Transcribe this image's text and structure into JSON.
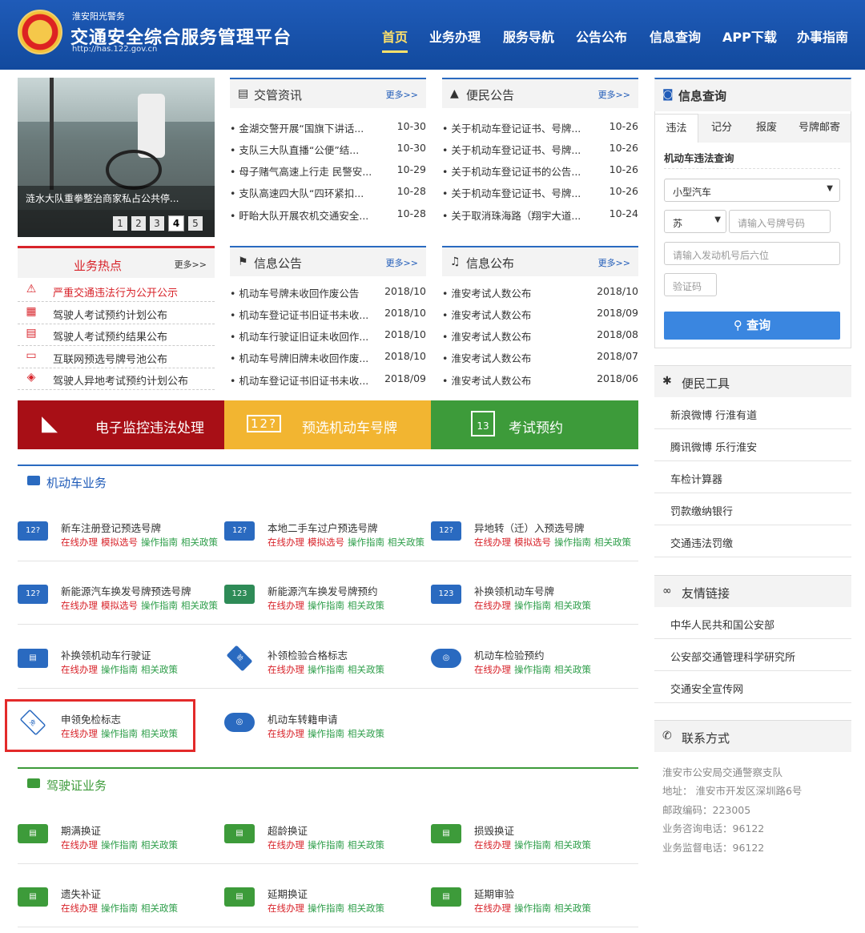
{
  "header": {
    "small": "淮安阳光警务",
    "title": "交通安全综合服务管理平台",
    "url": "http://has.122.gov.cn",
    "nav": [
      "首页",
      "业务办理",
      "服务导航",
      "公告公布",
      "信息查询",
      "APP下载",
      "办事指南"
    ]
  },
  "carousel": {
    "caption": "涟水大队重拳整治商家私占公共停...",
    "pages": [
      "1",
      "2",
      "3",
      "4",
      "5"
    ],
    "active": "4"
  },
  "news": {
    "title": "交管资讯",
    "more": "更多>>",
    "items": [
      {
        "t": "• 金湖交警开展“国旗下讲话...",
        "d": "10-30"
      },
      {
        "t": "• 支队三大队直播“公便”结...",
        "d": "10-30"
      },
      {
        "t": "• 母子赌气高速上行走 民警安...",
        "d": "10-29"
      },
      {
        "t": "• 支队高速四大队“四环紧扣...",
        "d": "10-28"
      },
      {
        "t": "• 盱眙大队开展农机交通安全...",
        "d": "10-28"
      }
    ]
  },
  "notice": {
    "title": "便民公告",
    "more": "更多>>",
    "items": [
      {
        "t": "• 关于机动车登记证书、号牌...",
        "d": "10-26"
      },
      {
        "t": "• 关于机动车登记证书、号牌...",
        "d": "10-26"
      },
      {
        "t": "• 关于机动车登记证书的公告...",
        "d": "10-26"
      },
      {
        "t": "• 关于机动车登记证书、号牌...",
        "d": "10-26"
      },
      {
        "t": "• 关于取消珠海路（翔宇大道...",
        "d": "10-24"
      }
    ]
  },
  "hot": {
    "title": "业务热点",
    "more": "更多>>",
    "items": [
      "严重交通违法行为公开公示",
      "驾驶人考试预约计划公布",
      "驾驶人考试预约结果公布",
      "互联网预选号牌号池公布",
      "驾驶人异地考试预约计划公布"
    ]
  },
  "info": {
    "title": "信息公告",
    "more": "更多>>",
    "items": [
      {
        "t": "• 机动车号牌未收回作废公告",
        "d": "2018/10"
      },
      {
        "t": "• 机动车登记证书旧证书未收...",
        "d": "2018/10"
      },
      {
        "t": "• 机动车行驶证旧证未收回作...",
        "d": "2018/10"
      },
      {
        "t": "• 机动车号牌旧牌未收回作废...",
        "d": "2018/10"
      },
      {
        "t": "• 机动车登记证书旧证书未收...",
        "d": "2018/09"
      }
    ]
  },
  "publish": {
    "title": "信息公布",
    "more": "更多>>",
    "items": [
      {
        "t": "• 淮安考试人数公布",
        "d": "2018/10"
      },
      {
        "t": "• 淮安考试人数公布",
        "d": "2018/09"
      },
      {
        "t": "• 淮安考试人数公布",
        "d": "2018/08"
      },
      {
        "t": "• 淮安考试人数公布",
        "d": "2018/07"
      },
      {
        "t": "• 淮安考试人数公布",
        "d": "2018/06"
      }
    ]
  },
  "banners": [
    {
      "label": "电子监控违法处理",
      "color": "#a80f16"
    },
    {
      "label": "预选机动车号牌",
      "color": "#f2b531"
    },
    {
      "label": "考试预约",
      "color": "#3d9b3a"
    }
  ],
  "vehicle": {
    "title": "机动车业务",
    "items": [
      {
        "name": "新车注册登记预选号牌",
        "links": [
          "在线办理",
          "模拟选号",
          "操作指南",
          "相关政策"
        ]
      },
      {
        "name": "本地二手车过户预选号牌",
        "links": [
          "在线办理",
          "模拟选号",
          "操作指南",
          "相关政策"
        ]
      },
      {
        "name": "异地转（迁）入预选号牌",
        "links": [
          "在线办理",
          "模拟选号",
          "操作指南",
          "相关政策"
        ]
      },
      {
        "name": "新能源汽车换发号牌预选号牌",
        "links": [
          "在线办理",
          "模拟选号",
          "操作指南",
          "相关政策"
        ]
      },
      {
        "name": "新能源汽车换发号牌预约",
        "links": [
          "在线办理",
          "操作指南",
          "相关政策"
        ]
      },
      {
        "name": "补换领机动车号牌",
        "links": [
          "在线办理",
          "操作指南",
          "相关政策"
        ]
      },
      {
        "name": "补换领机动车行驶证",
        "links": [
          "在线办理",
          "操作指南",
          "相关政策"
        ]
      },
      {
        "name": "补领检验合格标志",
        "links": [
          "在线办理",
          "操作指南",
          "相关政策"
        ]
      },
      {
        "name": "机动车检验预约",
        "links": [
          "在线办理",
          "操作指南",
          "相关政策"
        ]
      },
      {
        "name": "申领免检标志",
        "links": [
          "在线办理",
          "操作指南",
          "相关政策"
        ]
      },
      {
        "name": "机动车转籍申请",
        "links": [
          "在线办理",
          "操作指南",
          "相关政策"
        ]
      }
    ]
  },
  "license": {
    "title": "驾驶证业务",
    "items": [
      {
        "name": "期满换证",
        "links": [
          "在线办理",
          "操作指南",
          "相关政策"
        ]
      },
      {
        "name": "超龄换证",
        "links": [
          "在线办理",
          "操作指南",
          "相关政策"
        ]
      },
      {
        "name": "损毁换证",
        "links": [
          "在线办理",
          "操作指南",
          "相关政策"
        ]
      },
      {
        "name": "遗失补证",
        "links": [
          "在线办理",
          "操作指南",
          "相关政策"
        ]
      },
      {
        "name": "延期换证",
        "links": [
          "在线办理",
          "操作指南",
          "相关政策"
        ]
      },
      {
        "name": "延期审验",
        "links": [
          "在线办理",
          "操作指南",
          "相关政策"
        ]
      }
    ]
  },
  "query": {
    "title": "信息查询",
    "tabs": [
      "违法",
      "记分",
      "报废",
      "号牌邮寄"
    ],
    "subtitle": "机动车违法查询",
    "vehicle_type": "小型汽车",
    "province": "苏",
    "plate_placeholder": "请输入号牌号码",
    "engine_placeholder": "请输入发动机号后六位",
    "captcha_placeholder": "验证码",
    "button": "查询"
  },
  "tools": {
    "title": "便民工具",
    "items": [
      "新浪微博 行淮有道",
      "腾讯微博 乐行淮安",
      "车检计算器",
      "罚款缴纳银行",
      "交通违法罚缴"
    ]
  },
  "links": {
    "title": "友情链接",
    "items": [
      "中华人民共和国公安部",
      "公安部交通管理科学研究所",
      "交通安全宣传网"
    ]
  },
  "contact": {
    "title": "联系方式",
    "lines": [
      "淮安市公安局交通警察支队",
      "地址： 淮安市开发区深圳路6号",
      "邮政编码：223005",
      "业务咨询电话：96122",
      "业务监督电话：96122"
    ]
  }
}
